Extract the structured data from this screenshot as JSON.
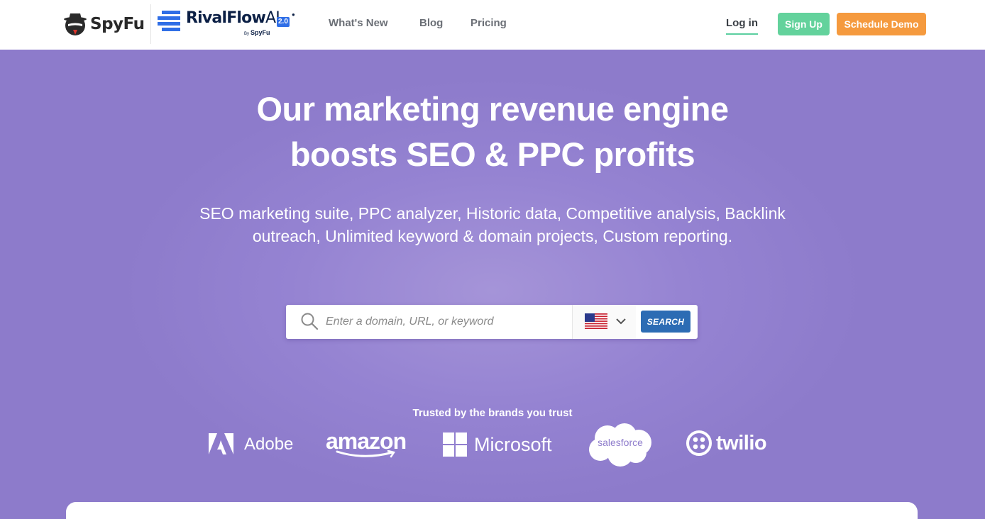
{
  "header": {
    "spyfu_logo": "SpyFu",
    "rivalflow_logo": {
      "name": "RivalFlow",
      "ai": "AI",
      "version": "2.0",
      "by_prefix": "By",
      "by_brand": "SpyFu"
    },
    "nav": [
      {
        "label": "What's New"
      },
      {
        "label": "Blog"
      },
      {
        "label": "Pricing"
      }
    ],
    "login_label": "Log in",
    "signup_label": "Sign Up",
    "demo_label": "Schedule Demo"
  },
  "hero": {
    "title_line1": "Our marketing revenue engine",
    "title_line2": "boosts SEO & PPC profits",
    "subtitle": "SEO marketing suite, PPC analyzer, Historic data, Competitive analysis, Backlink outreach, Unlimited keyword & domain projects, Custom reporting."
  },
  "search": {
    "placeholder": "Enter a domain, URL, or keyword",
    "value": "",
    "country_icon": "us-flag-icon",
    "button_label": "SEARCH"
  },
  "trusted": {
    "heading": "Trusted by the brands you trust",
    "brands": [
      {
        "name": "Adobe",
        "icon": "adobe-logo-icon"
      },
      {
        "name": "amazon",
        "icon": "amazon-smile-icon"
      },
      {
        "name": "Microsoft",
        "icon": "microsoft-windows-icon"
      },
      {
        "name": "salesforce",
        "icon": "salesforce-cloud-icon"
      },
      {
        "name": "twilio",
        "icon": "twilio-icon"
      }
    ]
  },
  "colors": {
    "hero_bg": "#8f7dcc",
    "signup_bg": "#63d29c",
    "demo_bg": "#f59a3e",
    "search_btn_bg": "#2c6cb4",
    "rivalflow_blue": "#2f6ee6"
  }
}
